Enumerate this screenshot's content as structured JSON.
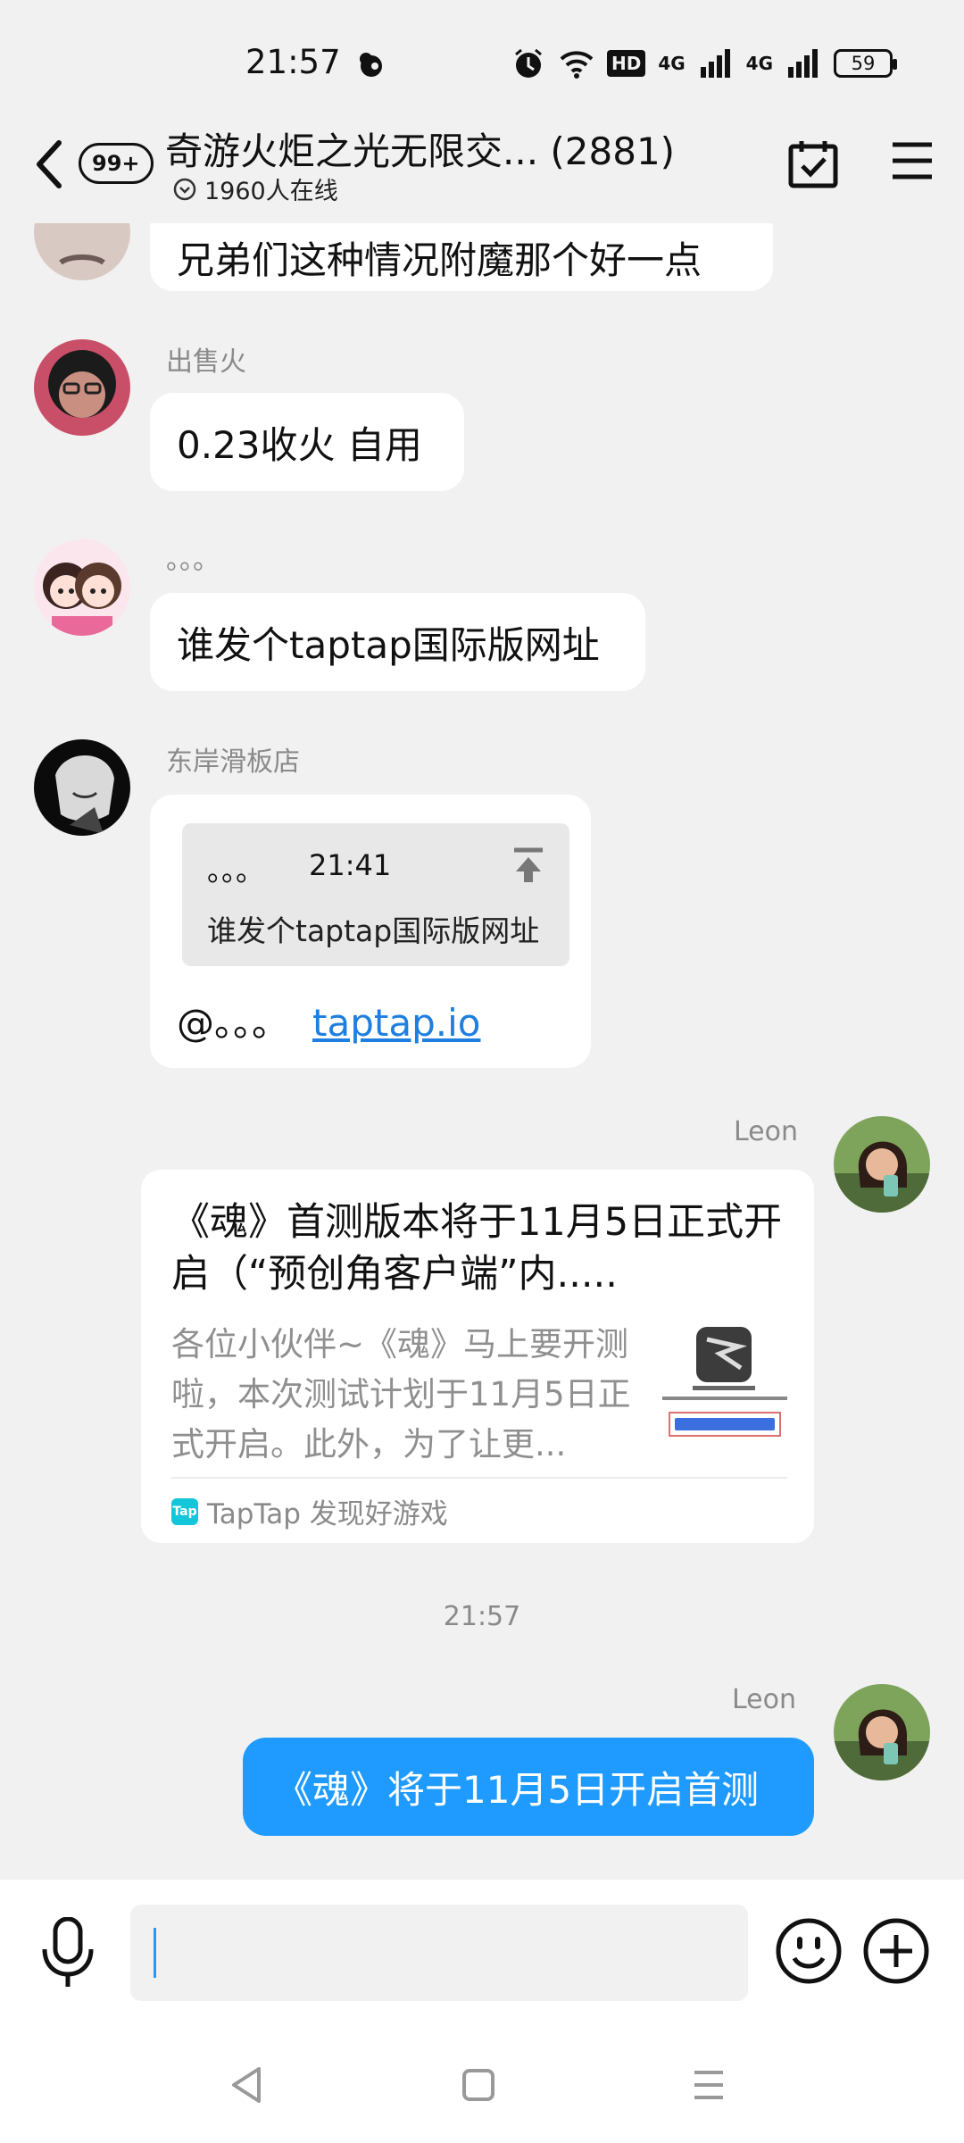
{
  "status_bar": {
    "time": "21:57",
    "network_1": "4G",
    "network_2": "4G",
    "hd": "HD",
    "battery": "59",
    "icons": [
      "bird-icon",
      "alarm-icon",
      "wifi-icon",
      "hd-icon",
      "signal-icon",
      "signal-icon",
      "battery-icon"
    ]
  },
  "header": {
    "unread_badge": "99+",
    "title": "奇游火炬之光无限交... (2881)",
    "online_count": "1960人在线"
  },
  "messages": [
    {
      "sender": "",
      "text": "兄弟们这种情况附魔那个好一点"
    },
    {
      "sender": "出售火",
      "text": "0.23收火 自用"
    },
    {
      "sender": "。。。",
      "text": "谁发个taptap国际版网址"
    },
    {
      "sender": "东岸滑板店",
      "quote": {
        "name": "。。。",
        "time": "21:41",
        "text": "谁发个taptap国际版网址"
      },
      "mention": "@。。。",
      "link": "taptap.io"
    },
    {
      "sender": "Leon",
      "card": {
        "title": "《魂》首测版本将于11月5日正式开启（“预创角客户端”内.....",
        "description": "各位小伙伴~《魂》马上要开测啦，本次测试计划于11月5日正式开启。此外，为了让更...",
        "source": "TapTap 发现好游戏",
        "source_logo": "Tap"
      }
    }
  ],
  "timestamp": "21:57",
  "last_message": {
    "sender": "Leon",
    "text": "《魂》将于11月5日开启首测"
  },
  "colors": {
    "accent": "#1f9bff",
    "link": "#1e7fe0",
    "background": "#f1f1f1"
  }
}
